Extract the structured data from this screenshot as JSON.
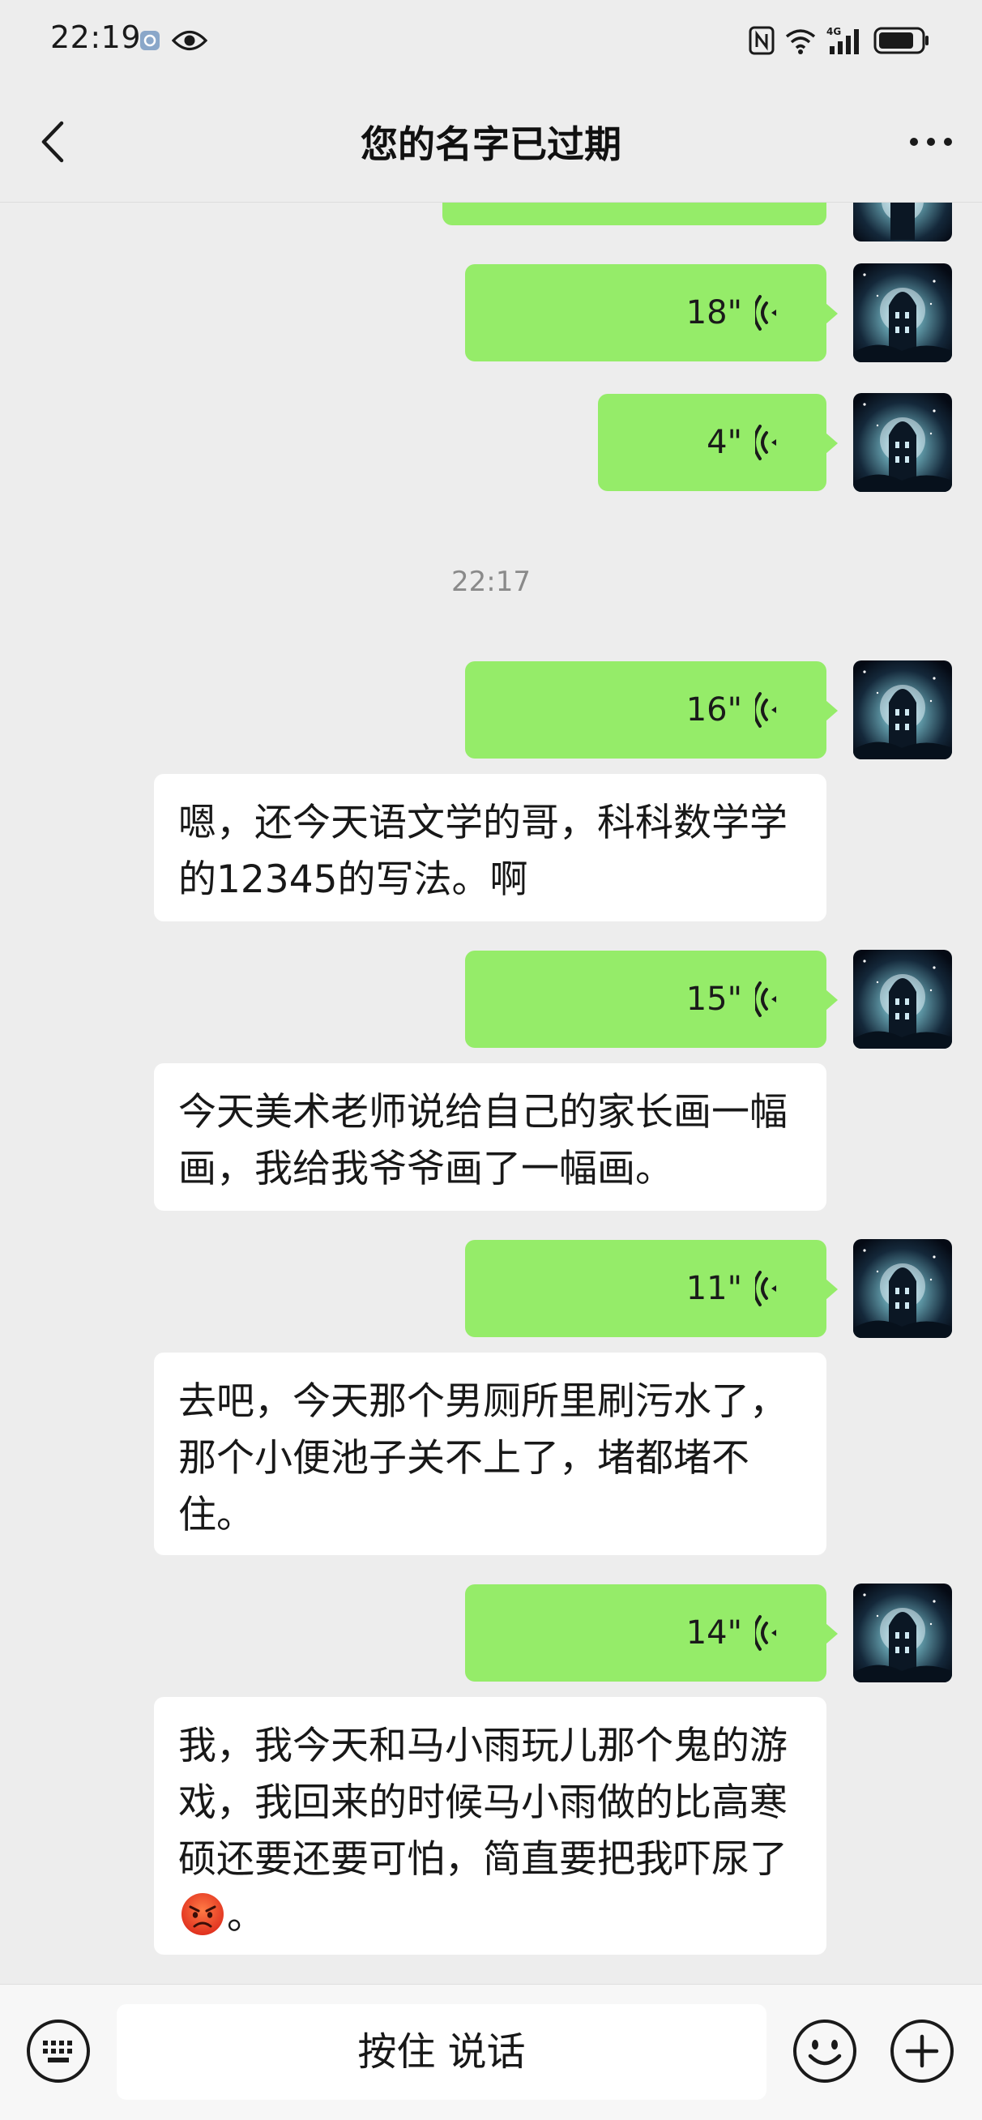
{
  "status_bar": {
    "time": "22:19",
    "network": "4G"
  },
  "header": {
    "title": "您的名字已过期"
  },
  "messages": {
    "voice_18": {
      "duration": "18\""
    },
    "voice_4": {
      "duration": "4\""
    },
    "timestamp": "22:17",
    "voice_16": {
      "duration": "16\""
    },
    "transcript_1": "嗯，还今天语文学的哥，科科数学学的12345的写法。啊",
    "voice_15": {
      "duration": "15\""
    },
    "transcript_2": "今天美术老师说给自己的家长画一幅画，我给我爷爷画了一幅画。",
    "voice_11": {
      "duration": "11\""
    },
    "transcript_3": "去吧，今天那个男厕所里刷污水了，那个小便池子关不上了，堵都堵不住。",
    "voice_14": {
      "duration": "14\""
    },
    "transcript_4_part1": "我，我今天和马小雨玩儿那个鬼的游戏，我回来的时候马小雨做的比高寒硕还要还要可怕，简直要把我吓尿了",
    "transcript_4_part2": "。"
  },
  "input_bar": {
    "hold_to_talk_label": "按住 说话"
  },
  "colors": {
    "background": "#ededed",
    "voice_bubble": "#95ec69",
    "text_card": "#ffffff",
    "timestamp_text": "#8a8a8a"
  },
  "icons": {
    "back": "chevron-left-icon",
    "more": "more-horizontal-icon",
    "voice": "voice-wave-icon",
    "keyboard": "keyboard-icon",
    "emoji": "smile-icon",
    "plus": "plus-circle-icon",
    "emoji_in_text": "angry-face-emoji"
  }
}
